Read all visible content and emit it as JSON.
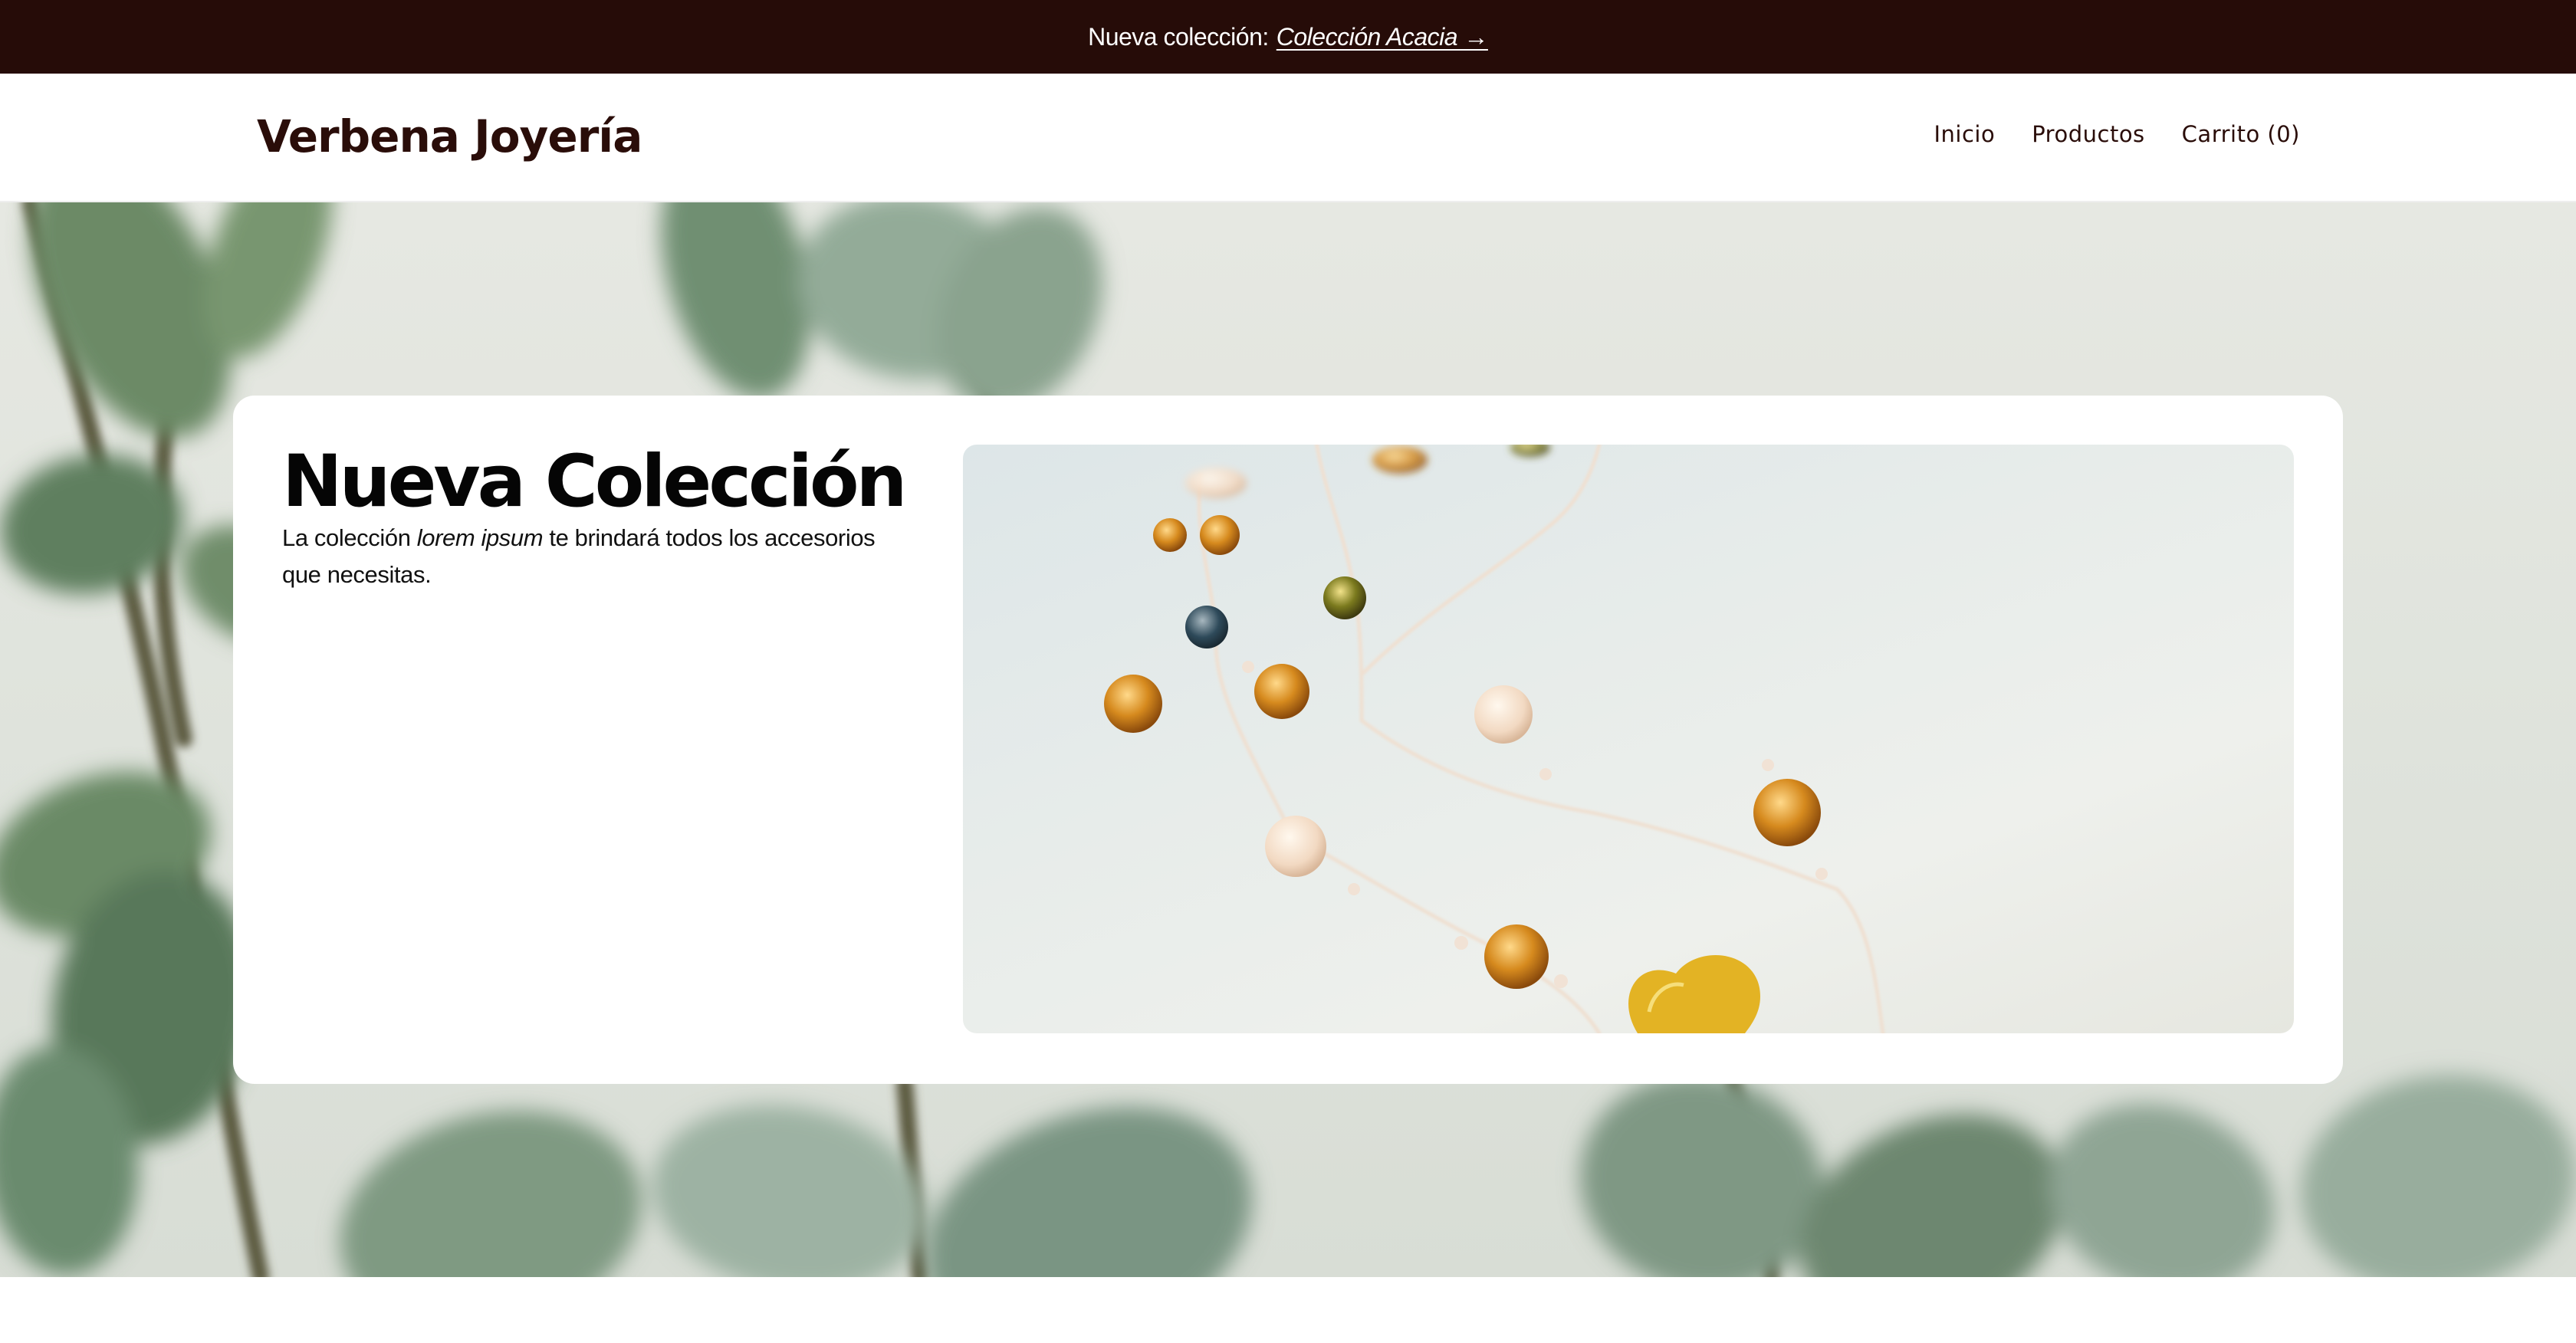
{
  "announcement": {
    "prefix": "Nueva colección:",
    "link_label": "Colección Acacia →"
  },
  "header": {
    "brand": "Verbena Joyería",
    "nav": [
      {
        "label": "Inicio"
      },
      {
        "label": "Productos"
      },
      {
        "label": "Carrito (0)"
      }
    ]
  },
  "hero": {
    "title": "Nueva Colección",
    "description_before": "La colección ",
    "description_em": "lorem ipsum",
    "description_after": " te brindará todos los accesorios que necesitas."
  },
  "colors": {
    "announcement_bg": "#260c08",
    "brand_text": "#2a0d09"
  }
}
